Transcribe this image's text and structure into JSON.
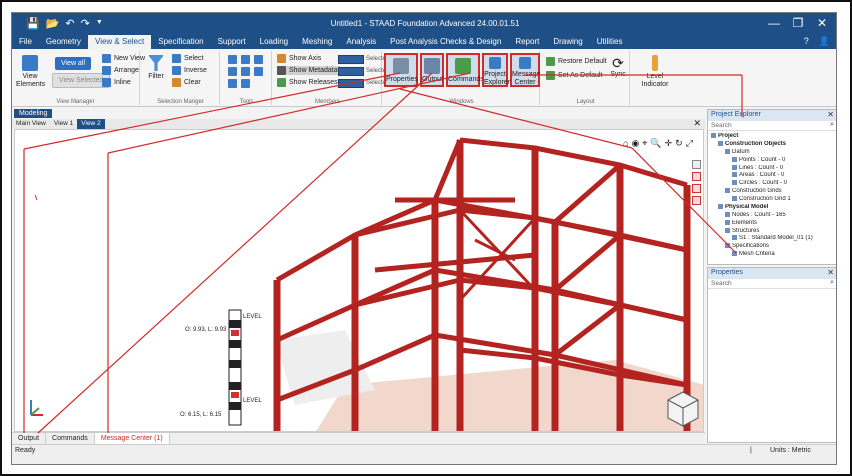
{
  "app": {
    "title": "Untitled1 - STAAD Foundation Advanced 24.00.01.51",
    "quick_access": [
      "💾",
      "📂",
      "↶",
      "↷",
      "▼"
    ],
    "window_buttons": {
      "minimize": "—",
      "restore": "❐",
      "close": "✕"
    }
  },
  "menu": {
    "items": [
      "File",
      "Geometry",
      "View & Select",
      "Specification",
      "Support",
      "Loading",
      "Meshing",
      "Analysis",
      "Post Analysis Checks & Design",
      "Report",
      "Drawing",
      "Utilities"
    ],
    "active": "View & Select",
    "help_icon": "?",
    "user_icon": "👤"
  },
  "ribbon": {
    "view_manager": {
      "label": "View Manager",
      "view_elements": "View Elements",
      "view_all": "View all",
      "view_selected": "View Selected",
      "new_view": "New View",
      "arrange": "Arrange",
      "inline": "Inline"
    },
    "selection_manager": {
      "label": "Selection Manger",
      "filter": "Filter",
      "select": "Select",
      "inverse": "Inverse",
      "clear": "Clear"
    },
    "tools": {
      "label": "Tools"
    },
    "members": {
      "label": "Members",
      "show_axis": "Show Axis",
      "show_metadata": "Show Metadata",
      "show_releases": "Show Releases",
      "selected": "Selected"
    },
    "windows": {
      "label": "Windows",
      "properties": "Properties",
      "output": "Output",
      "commands": "Commands",
      "project_explorer": "Project Explorer",
      "message_center": "Message Center"
    },
    "layout": {
      "label": "Layout",
      "restore_default": "Restore Default",
      "set_as_default": "Set As Default",
      "sync": "Sync",
      "level_indicator": "Level Indicator"
    }
  },
  "modeling": {
    "tab": "Modeling",
    "views": [
      "Main View",
      "View 1",
      "View 2"
    ],
    "active_view": "View 2",
    "labels": {
      "level_top": "LEVEL",
      "level_bottom": "LEVEL",
      "coord_top": "O: 9.93, L: 9.93",
      "coord_bottom": "O: 6.15, L: 6.15"
    },
    "toolbar_icons": [
      "⌂",
      "◉",
      "⌖",
      "🔍",
      "✛",
      "↻",
      "⤢"
    ]
  },
  "bottom_tabs": [
    "Output",
    "Commands",
    "Message Center (1)"
  ],
  "status": {
    "left": "Ready",
    "right": "Units : Metric"
  },
  "project_explorer": {
    "title": "Project Explorer",
    "search": "Search",
    "tree": [
      {
        "text": "Project",
        "indent": 0,
        "bold": true
      },
      {
        "text": "Construction Objects",
        "indent": 1,
        "bold": true
      },
      {
        "text": "Datum",
        "indent": 2,
        "bold": false
      },
      {
        "text": "Points : Count - 0",
        "indent": 3,
        "bold": false
      },
      {
        "text": "Lines : Count - 0",
        "indent": 3,
        "bold": false
      },
      {
        "text": "Areas : Count - 0",
        "indent": 3,
        "bold": false
      },
      {
        "text": "Circles : Count - 0",
        "indent": 3,
        "bold": false
      },
      {
        "text": "Construction Grids",
        "indent": 2,
        "bold": false
      },
      {
        "text": "Construction Grid 1",
        "indent": 3,
        "bold": false
      },
      {
        "text": "Physical Model",
        "indent": 1,
        "bold": true
      },
      {
        "text": "Nodes : Count - 165",
        "indent": 2,
        "bold": false
      },
      {
        "text": "Elements",
        "indent": 2,
        "bold": false
      },
      {
        "text": "Structures",
        "indent": 2,
        "bold": false
      },
      {
        "text": "S1 : Standard Model_01 (1)",
        "indent": 3,
        "bold": false
      },
      {
        "text": "Specifications",
        "indent": 2,
        "bold": false
      },
      {
        "text": "Mesh Criteria",
        "indent": 3,
        "bold": false
      }
    ]
  },
  "properties": {
    "title": "Properties",
    "search": "Search"
  },
  "colors": {
    "brand": "#1e4f86",
    "highlight": "#d12a2a",
    "member": "#b3231f"
  }
}
